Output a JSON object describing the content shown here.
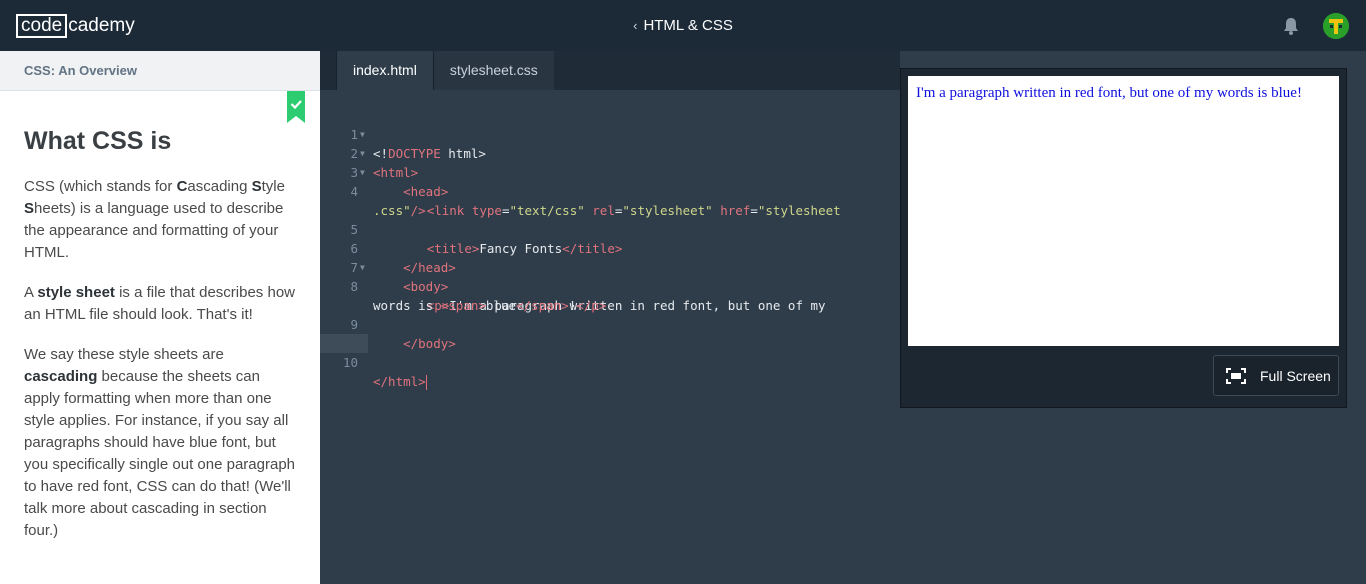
{
  "header": {
    "logo_boxed": "code",
    "logo_rest": "cademy",
    "back_chevron": "‹",
    "course_title": "HTML & CSS",
    "icons": [
      "bell-icon",
      "avatar"
    ]
  },
  "lesson": {
    "section_title": "CSS: An Overview",
    "completed": true,
    "heading": "What CSS is",
    "paragraphs": {
      "p1": {
        "a": "CSS (which stands for ",
        "b1": "C",
        "c": "ascading ",
        "b2": "S",
        "d": "tyle ",
        "b3": "S",
        "e": "heets) is a language used to describe the appearance and formatting of your HTML."
      },
      "p2": {
        "a": "A ",
        "b": "style sheet",
        "c": " is a file that describes how an HTML file should look. That's it!"
      },
      "p3": {
        "a": "We say these style sheets are ",
        "b": "cascading",
        "c": " because the sheets can apply formatting when more than one style applies. For instance, if you say all paragraphs should have blue font, but you specifically single out one paragraph to have red font, CSS can do that! (We'll talk more about cascading in section four.)"
      }
    }
  },
  "editor": {
    "tabs": [
      {
        "label": "index.html",
        "active": true
      },
      {
        "label": "stylesheet.css",
        "active": false
      }
    ],
    "line_numbers": [
      "1",
      "2",
      "3",
      "4",
      "",
      "5",
      "6",
      "7",
      "8",
      "",
      "9",
      "10"
    ],
    "current_line": "10",
    "code": {
      "l1_lt": "<!",
      "l1_doctype": "DOCTYPE",
      "l1_rest": " html>",
      "l2": "<html>",
      "l3": "<head>",
      "l4_tag": "<link ",
      "l4_a1": "type",
      "l4_v1": "\"text/css\"",
      "l4_a2": "rel",
      "l4_v2": "\"stylesheet\"",
      "l4_a3": "href",
      "l4_v3a": "\"stylesheet",
      "l4_v3b": ".css\"",
      "l4_close": "/>",
      "l5_open": "<title>",
      "l5_text": "Fancy Fonts",
      "l5_close": "</title>",
      "l6": "</head>",
      "l7": "<body>",
      "l8_open": "<p>",
      "l8_text": "I'm a paragraph written in red font, but one of my",
      "l8b_text": "words is ",
      "l8b_span_open": "<span>",
      "l8b_span_text": "blue",
      "l8b_span_close": "</span>",
      "l8b_bang": "!",
      "l8b_p_close": "</p>",
      "l9": "</body>",
      "l10": "</html>"
    }
  },
  "preview": {
    "text": "I'm a paragraph written in red font, but one of my words is blue!",
    "fullscreen_label": "Full Screen"
  },
  "colors": {
    "topbar": "#1c2a38",
    "editor_bg": "#2f3d4b",
    "tag": "#e0737c",
    "string": "#cfd68a",
    "preview_text": "#1010dd",
    "check_ribbon": "#2ecc71"
  }
}
